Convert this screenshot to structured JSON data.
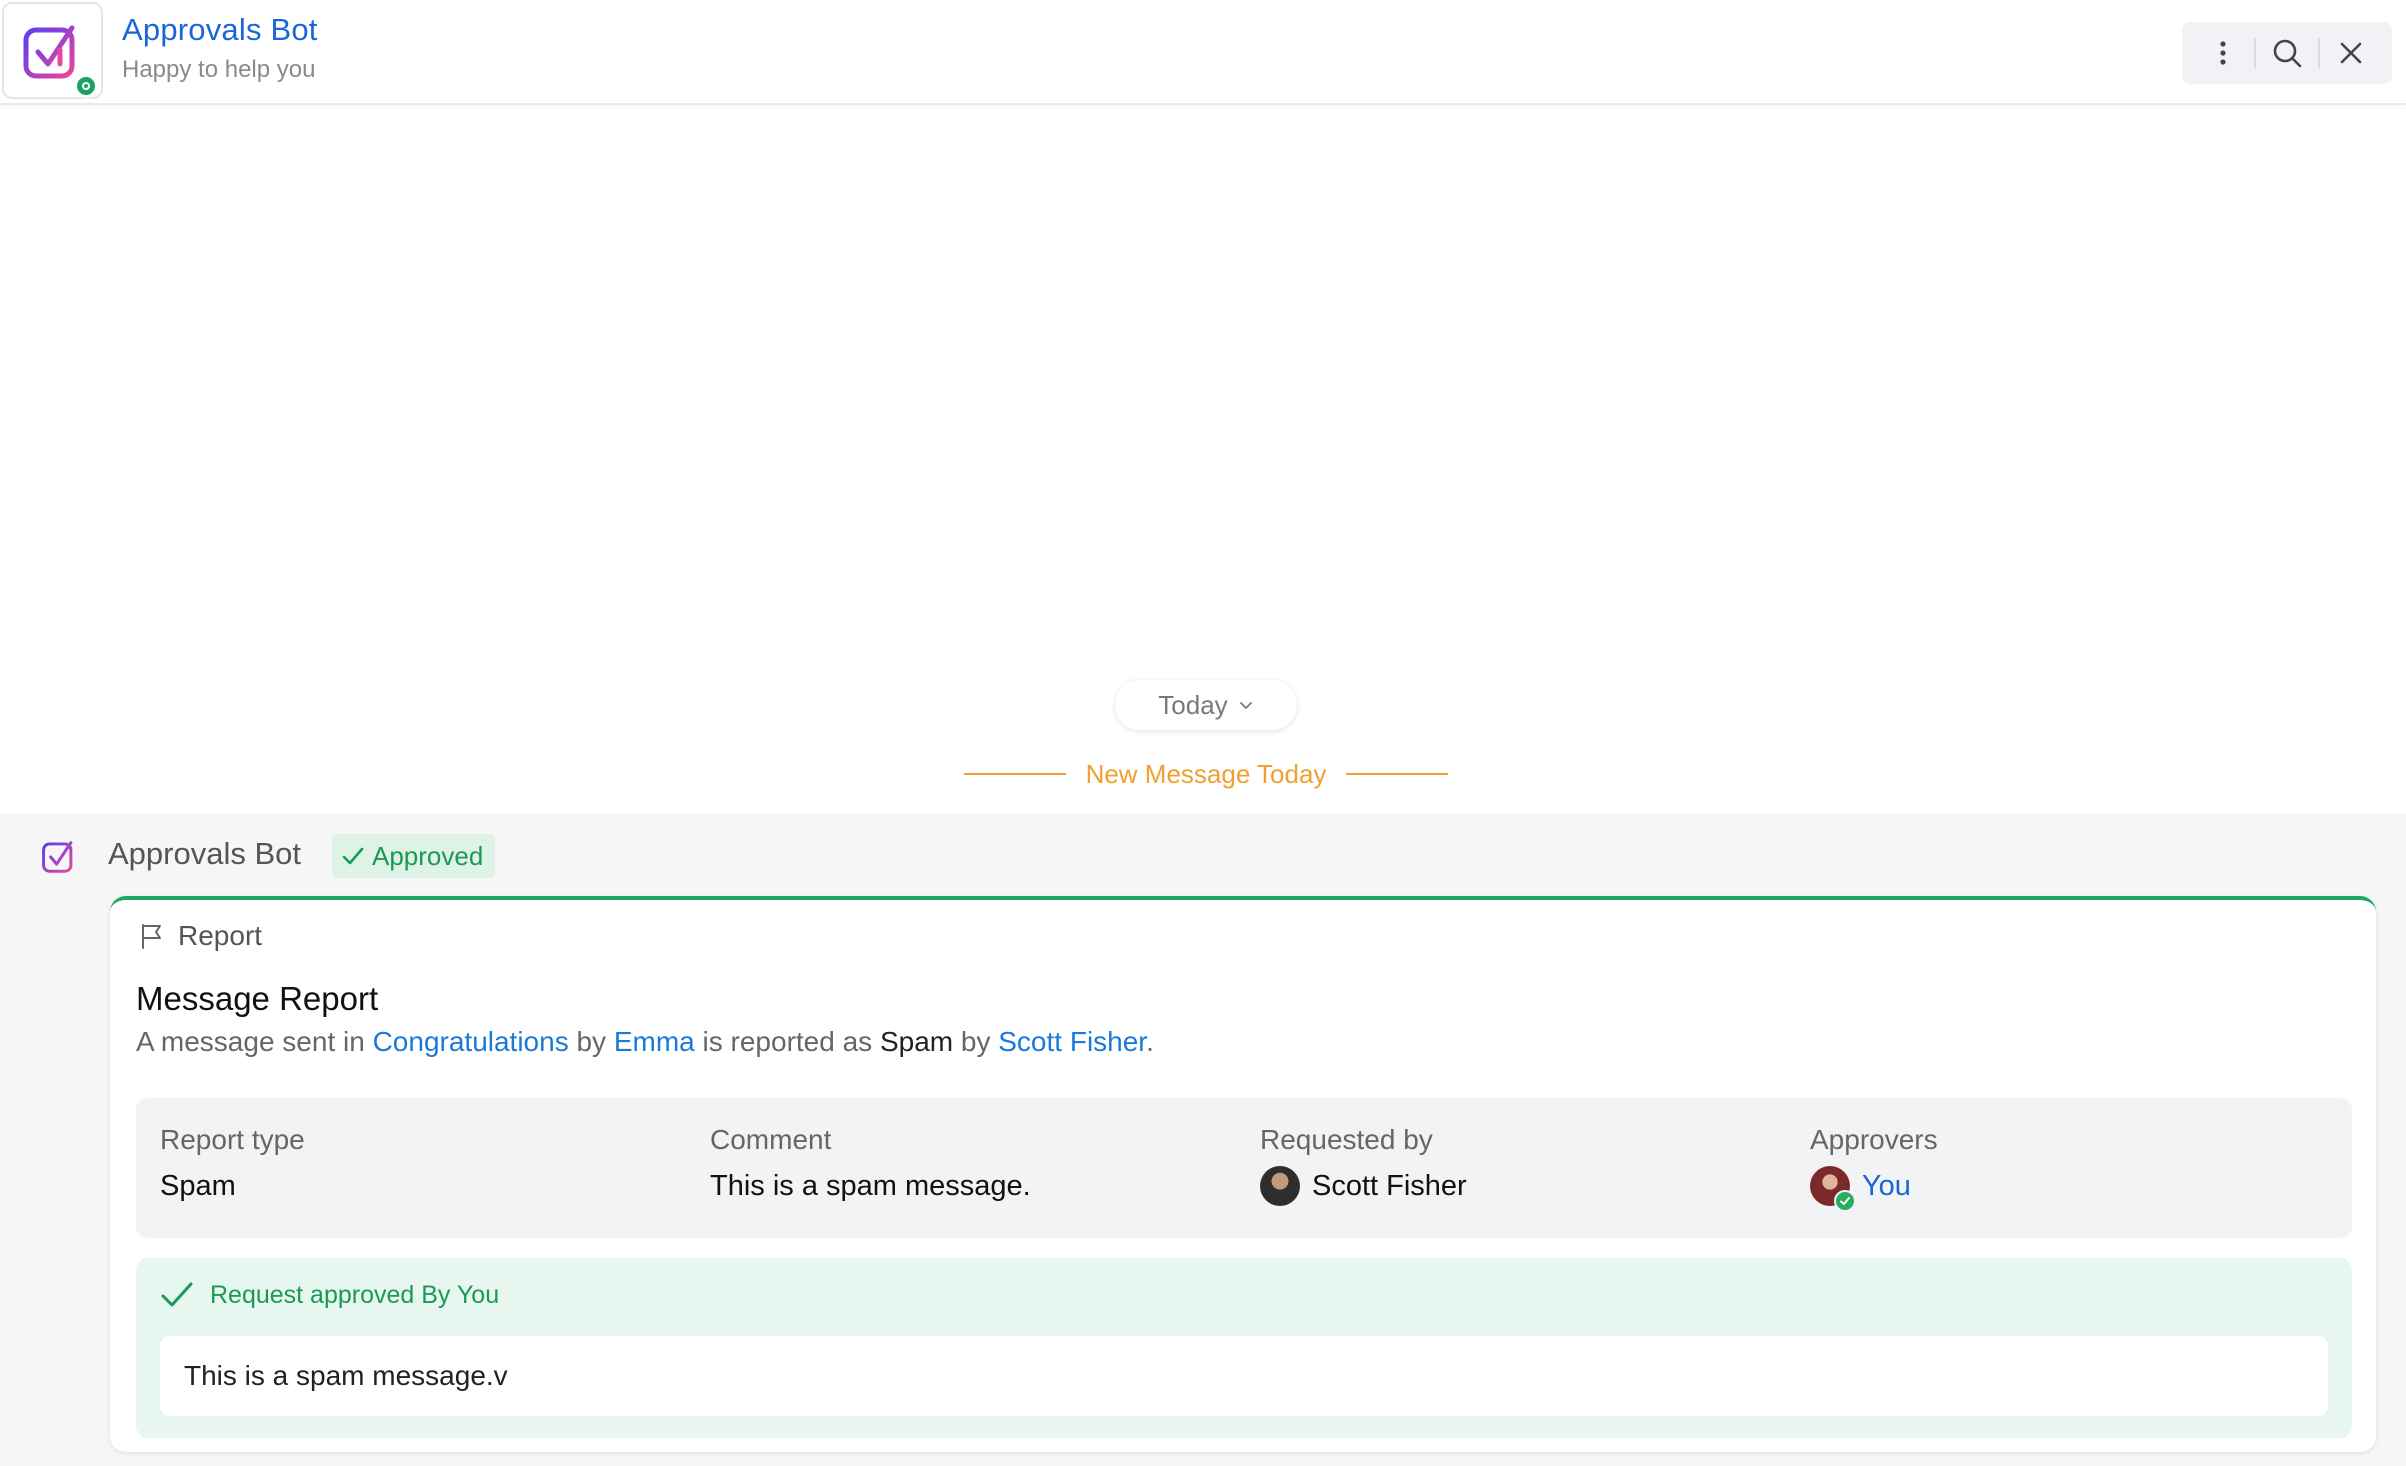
{
  "header": {
    "title": "Approvals Bot",
    "subtitle": "Happy to help you",
    "icons": [
      "more-vertical-icon",
      "search-icon",
      "close-icon"
    ]
  },
  "timeline": {
    "date_label": "Today",
    "new_message_label": "New Message Today"
  },
  "message": {
    "sender": "Approvals Bot",
    "status_badge": "Approved",
    "card": {
      "type_label": "Report",
      "title": "Message Report",
      "description": {
        "part1": "A message sent in ",
        "channel": "Congratulations",
        "part2": " by ",
        "author": "Emma",
        "part3": " is reported as ",
        "report_kind": "Spam",
        "part4": " by ",
        "reporter": "Scott Fisher",
        "part5": "."
      },
      "details": {
        "report_type_label": "Report type",
        "report_type_value": "Spam",
        "comment_label": "Comment",
        "comment_value": "This is a spam message.",
        "requested_by_label": "Requested by",
        "requested_by_value": "Scott Fisher",
        "approvers_label": "Approvers",
        "approvers_value": "You"
      },
      "approval": {
        "status_text": "Request approved By You",
        "comment": "This is a spam message.v"
      }
    }
  },
  "colors": {
    "link_blue": "#1a66d9",
    "approved_green": "#1a9a55",
    "new_message_orange": "#f0a030"
  }
}
